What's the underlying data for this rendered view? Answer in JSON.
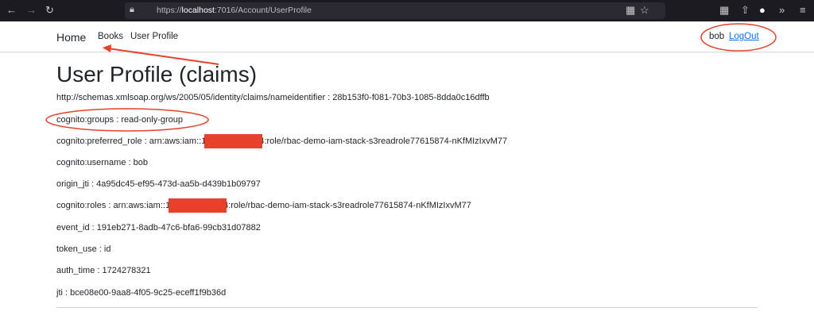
{
  "browser": {
    "url_prefix": "https://",
    "url_host": "localhost",
    "url_path": ":7016/Account/UserProfile"
  },
  "nav": {
    "brand": "Home",
    "links": [
      "Books",
      "User Profile"
    ],
    "user": "bob",
    "logout": "LogOut"
  },
  "page": {
    "title": "User Profile (claims)"
  },
  "claims": [
    {
      "text": "http://schemas.xmlsoap.org/ws/2005/05/identity/claims/nameidentifier : 28b153f0-f081-70b3-1085-8dda0c16dffb"
    },
    {
      "text": "cognito:groups : read-only-group"
    },
    {
      "pre": "cognito:preferred_role : arn:aws:iam::1",
      "post": "4:role/rbac-demo-iam-stack-s3readrole77615874-nKfMIzIxvM77"
    },
    {
      "text": "cognito:username : bob"
    },
    {
      "text": "origin_jti : 4a95dc45-ef95-473d-aa5b-d439b1b09797"
    },
    {
      "pre": "cognito:roles : arn:aws:iam::1",
      "post": "4:role/rbac-demo-iam-stack-s3readrole77615874-nKfMIzIxvM77"
    },
    {
      "text": "event_id : 191eb271-8adb-47c6-bfa6-99cb31d07882"
    },
    {
      "text": "token_use : id"
    },
    {
      "text": "auth_time : 1724278321"
    },
    {
      "text": "jti : bce08e00-9aa8-4f05-9c25-eceff1f9b36d"
    }
  ],
  "colors": {
    "annotation": "#e8402a",
    "link": "#0d6efd"
  }
}
